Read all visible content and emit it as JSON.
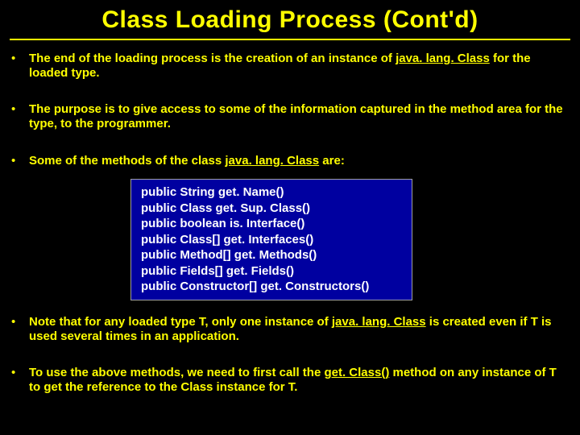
{
  "title": "Class Loading Process (Cont'd)",
  "bullets": {
    "b1a": "The end of the loading process is the creation of an instance of ",
    "b1u": "java. lang. Class",
    "b1b": " for the loaded type.",
    "b2": "The purpose is to give access to some of the information captured in the method area for the type, to the programmer.",
    "b3a": "Some of the methods of the class ",
    "b3u": "java. lang. Class",
    "b3b": " are:",
    "b4a": "Note that for any loaded type T, only one instance of ",
    "b4u": "java. lang. Class",
    "b4b": " is created even if T is used several times in an application.",
    "b5a": "To use the above methods, we need to first call the ",
    "b5u": "get. Class()",
    "b5b": " method on any instance of T to get the reference to the Class instance for T."
  },
  "code": {
    "l1": "public String get. Name()",
    "l2": "public Class get. Sup. Class()",
    "l3": "public boolean is. Interface()",
    "l4": "public Class[] get. Interfaces()",
    "l5": "public Method[] get. Methods()",
    "l6": "public Fields[] get. Fields()",
    "l7": "public Constructor[] get. Constructors()"
  }
}
